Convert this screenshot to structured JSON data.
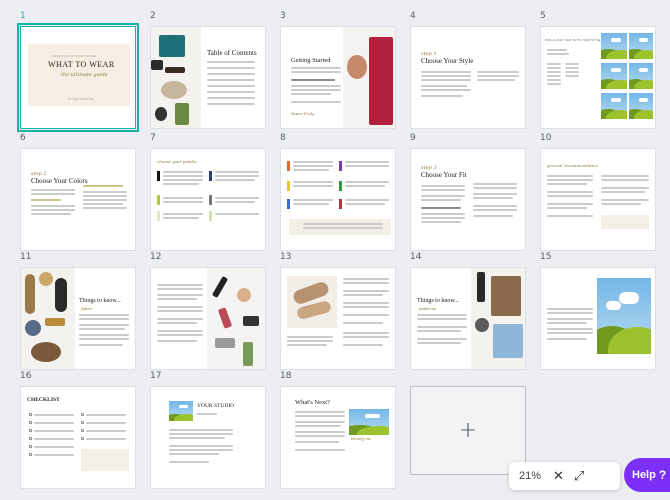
{
  "pages": [
    {
      "number": "1",
      "cover_line1": "WHAT TO WEAR",
      "cover_line2": "the ultimate guide",
      "cover_eyebrow": "FASHION & STYLING GUIDE",
      "cover_footer": "GUIDE EDITION"
    },
    {
      "number": "2",
      "title": "Table of Contents"
    },
    {
      "number": "3",
      "title": "Getting Started"
    },
    {
      "number": "4",
      "eyebrow": "step 1",
      "title": "Choose Your Style"
    },
    {
      "number": "5",
      "title": "PICK A LOOK THAT SUITS YOUR STYLE"
    },
    {
      "number": "6",
      "eyebrow": "step 2",
      "title": "Choose Your Colors"
    },
    {
      "number": "7",
      "title": "choose your palette"
    },
    {
      "number": "8"
    },
    {
      "number": "9",
      "eyebrow": "step 3",
      "title": "Choose Your Fit"
    },
    {
      "number": "10",
      "title": "general recommendation"
    },
    {
      "number": "11",
      "title": "Things to know...",
      "subtitle": "fabric"
    },
    {
      "number": "12"
    },
    {
      "number": "13"
    },
    {
      "number": "14",
      "title": "Things to know...",
      "subtitle": "patterns"
    },
    {
      "number": "15"
    },
    {
      "number": "16",
      "title": "CHECKLIST"
    },
    {
      "number": "17",
      "title": "YOUR STUDIO"
    },
    {
      "number": "18",
      "title": "What's Next?",
      "signature": "Identify me"
    }
  ],
  "add_page": {
    "icon": "plus-icon",
    "label": "+"
  },
  "zoom": {
    "percent": "21%",
    "close_icon": "close-icon",
    "expand_icon": "expand-icon"
  },
  "help": {
    "label": "Help",
    "glyph": "?"
  },
  "colors": {
    "accent": "#18b3a8",
    "help": "#7b2ff7"
  }
}
